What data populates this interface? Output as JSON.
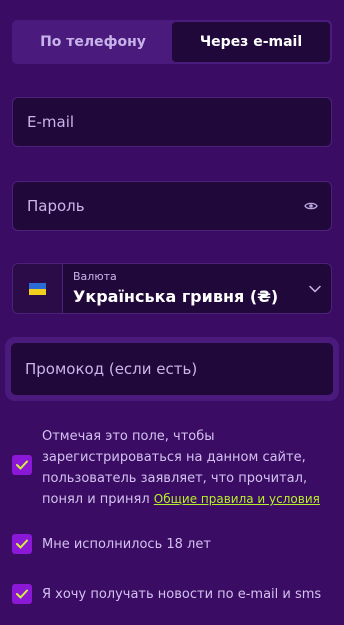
{
  "tabs": {
    "phone_label": "По телефону",
    "email_label": "Через e-mail"
  },
  "form": {
    "email_placeholder": "E-mail",
    "password_placeholder": "Пароль",
    "currency": {
      "label": "Валюта",
      "value": "Українська гривня (₴)",
      "flag": "ukraine-flag"
    },
    "promo_placeholder": "Промокод (если есть)"
  },
  "checkboxes": {
    "terms_text": "Отмечая это поле, чтобы зарегистрироваться на данном сайте, пользователь заявляет, что прочитал, понял и принял",
    "terms_link": "Общие правила и условия",
    "age_text": "Мне исполнилось 18 лет",
    "news_text": "Я хочу получать новости по e-mail и sms"
  },
  "colors": {
    "background": "#3a0c63",
    "field_bg": "#21083a",
    "accent": "#8a18d6",
    "link": "#b7f02b",
    "check": "#d6f23a"
  },
  "icons": [
    "eye-icon",
    "chevron-down-icon",
    "checkmark-icon"
  ]
}
